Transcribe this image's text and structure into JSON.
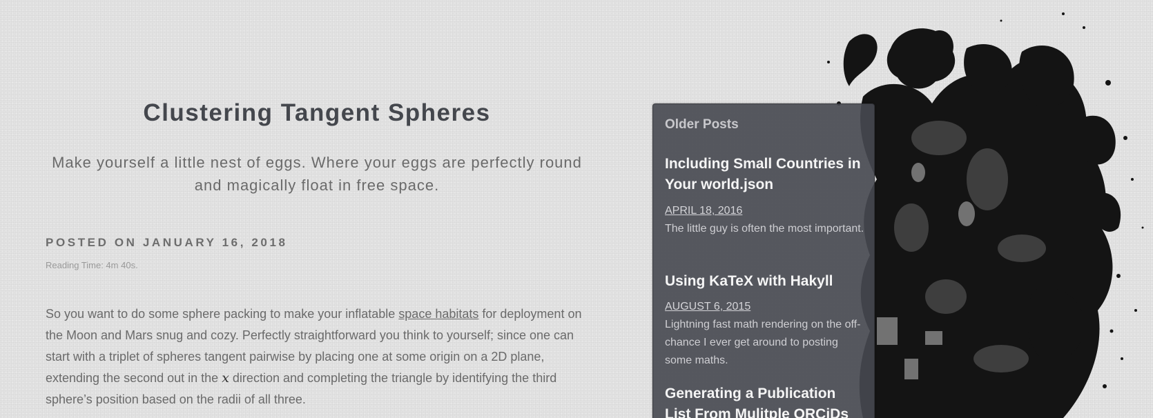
{
  "post": {
    "title": "Clustering Tangent Spheres",
    "subtitle": "Make yourself a little nest of eggs. Where your eggs are perfectly round and magically float in free space.",
    "posted_on": "POSTED ON JANUARY 16, 2018",
    "reading_time": "Reading Time: 4m 40s.",
    "body": {
      "part1": "So you want to do some sphere packing to make your inflatable ",
      "link_text": "space habitats",
      "part2": " for deployment on the Moon and Mars snug and cozy. Perfectly straightforward you think to yourself; since one can start with a triplet of spheres tangent pairwise by placing one at some origin on a 2D plane, extending the second out in the ",
      "math_var": "x",
      "part3": " direction and completing the triangle by identifying the third sphere’s position based on the radii of all three."
    }
  },
  "sidebar": {
    "heading": "Older Posts",
    "entries": [
      {
        "title": "Including Small Countries in Your world.json",
        "date": "APRIL 18, 2016",
        "description": "The little guy is often the most important."
      },
      {
        "title": "Using KaTeX with Hakyll",
        "date": "AUGUST 6, 2015",
        "description": "Lightning fast math rendering on the off-chance I ever get around to posting some maths."
      },
      {
        "title": "Generating a Publication List From Mulitple ORCiDs",
        "date": "",
        "description": ""
      }
    ]
  },
  "colors": {
    "background": "#e2e2e2",
    "sidebar_bg": "#464850",
    "title_text": "#44474d",
    "crest": "#111111"
  }
}
